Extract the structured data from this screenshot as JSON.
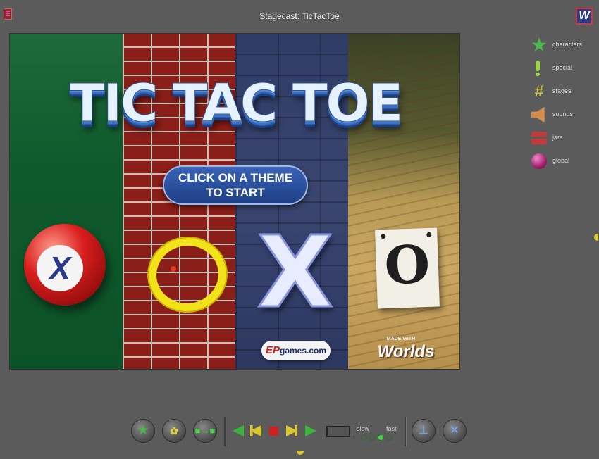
{
  "window": {
    "title": "Stagecast: TicTacToe"
  },
  "game": {
    "title": "TIC TAC TOE",
    "start_line1": "CLICK ON A THEME",
    "start_line2": "TO START",
    "themes": [
      {
        "name": "billiards",
        "symbol": "X"
      },
      {
        "name": "brick",
        "symbol": "O"
      },
      {
        "name": "stone",
        "symbol": "X"
      },
      {
        "name": "wood",
        "symbol": "O"
      }
    ],
    "sponsor_ep": "EP",
    "sponsor_games": "games",
    "sponsor_com": ".com",
    "made_with": "MADE WITH",
    "worlds": "Worlds"
  },
  "sidebar": {
    "items": [
      {
        "label": "characters",
        "icon": "star-icon"
      },
      {
        "label": "special",
        "icon": "exclamation-icon"
      },
      {
        "label": "stages",
        "icon": "grid-icon"
      },
      {
        "label": "sounds",
        "icon": "speaker-icon"
      },
      {
        "label": "jars",
        "icon": "jar-icon"
      },
      {
        "label": "global",
        "icon": "globe-icon"
      }
    ]
  },
  "toolbar": {
    "speed_slow": "slow",
    "speed_fast": "fast",
    "speed_level": 3,
    "speed_steps": 4
  },
  "colors": {
    "background": "#5b5b5b",
    "play_green": "#3db33d",
    "step_yellow": "#d8c632",
    "stop_red": "#cc2222"
  }
}
